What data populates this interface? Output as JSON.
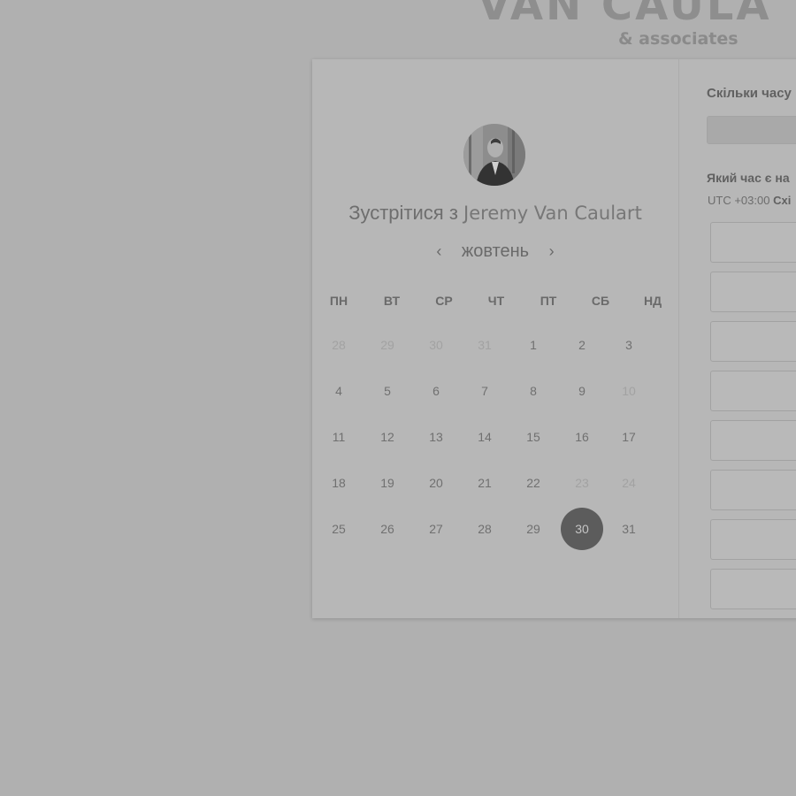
{
  "brand": {
    "name": "VAN CAULA",
    "tagline": "& associates"
  },
  "calendar": {
    "title_prefix": "Зустрітися з",
    "host_name": "Jeremy Van Caulart",
    "month": "жовтень",
    "prev_icon": "chevron-left-icon",
    "next_icon": "chevron-right-icon",
    "weekdays": [
      "ПН",
      "ВТ",
      "СР",
      "ЧТ",
      "ПТ",
      "СБ",
      "НД"
    ],
    "weeks": [
      [
        {
          "d": "28",
          "s": "faded"
        },
        {
          "d": "29",
          "s": "faded"
        },
        {
          "d": "30",
          "s": "faded"
        },
        {
          "d": "31",
          "s": "faded"
        },
        {
          "d": "1",
          "s": "normal"
        },
        {
          "d": "2",
          "s": "normal"
        },
        {
          "d": "3",
          "s": "normal"
        }
      ],
      [
        {
          "d": "4",
          "s": "normal"
        },
        {
          "d": "5",
          "s": "normal"
        },
        {
          "d": "6",
          "s": "normal"
        },
        {
          "d": "7",
          "s": "normal"
        },
        {
          "d": "8",
          "s": "normal"
        },
        {
          "d": "9",
          "s": "normal"
        },
        {
          "d": "10",
          "s": "faded"
        }
      ],
      [
        {
          "d": "11",
          "s": "normal"
        },
        {
          "d": "12",
          "s": "normal"
        },
        {
          "d": "13",
          "s": "normal"
        },
        {
          "d": "14",
          "s": "normal"
        },
        {
          "d": "15",
          "s": "normal"
        },
        {
          "d": "16",
          "s": "normal"
        },
        {
          "d": "17",
          "s": "normal"
        }
      ],
      [
        {
          "d": "18",
          "s": "normal"
        },
        {
          "d": "19",
          "s": "normal"
        },
        {
          "d": "20",
          "s": "normal"
        },
        {
          "d": "21",
          "s": "normal"
        },
        {
          "d": "22",
          "s": "normal"
        },
        {
          "d": "23",
          "s": "faded"
        },
        {
          "d": "24",
          "s": "faded"
        }
      ],
      [
        {
          "d": "25",
          "s": "normal"
        },
        {
          "d": "26",
          "s": "normal"
        },
        {
          "d": "27",
          "s": "normal"
        },
        {
          "d": "28",
          "s": "normal"
        },
        {
          "d": "29",
          "s": "normal"
        },
        {
          "d": "30",
          "s": "selected"
        },
        {
          "d": "31",
          "s": "normal"
        }
      ]
    ]
  },
  "booking": {
    "duration_question": "Скільки часу",
    "time_question": "Який час є на",
    "timezone_offset": "UTC +03:00",
    "timezone_name": "Схі",
    "slot_count": 8
  }
}
